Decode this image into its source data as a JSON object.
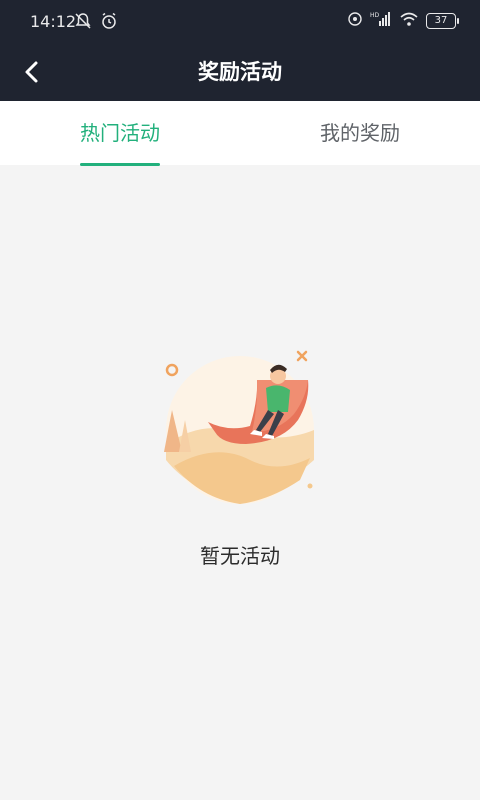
{
  "status_bar": {
    "time": "14:12",
    "battery": "37",
    "network_label": "HD"
  },
  "header": {
    "title": "奖励活动"
  },
  "tabs": [
    {
      "label": "热门活动",
      "active": true
    },
    {
      "label": "我的奖励",
      "active": false
    }
  ],
  "empty_state": {
    "message": "暂无活动"
  },
  "colors": {
    "header_bg": "#1f2430",
    "accent": "#22b07c",
    "page_bg": "#f4f4f4"
  }
}
